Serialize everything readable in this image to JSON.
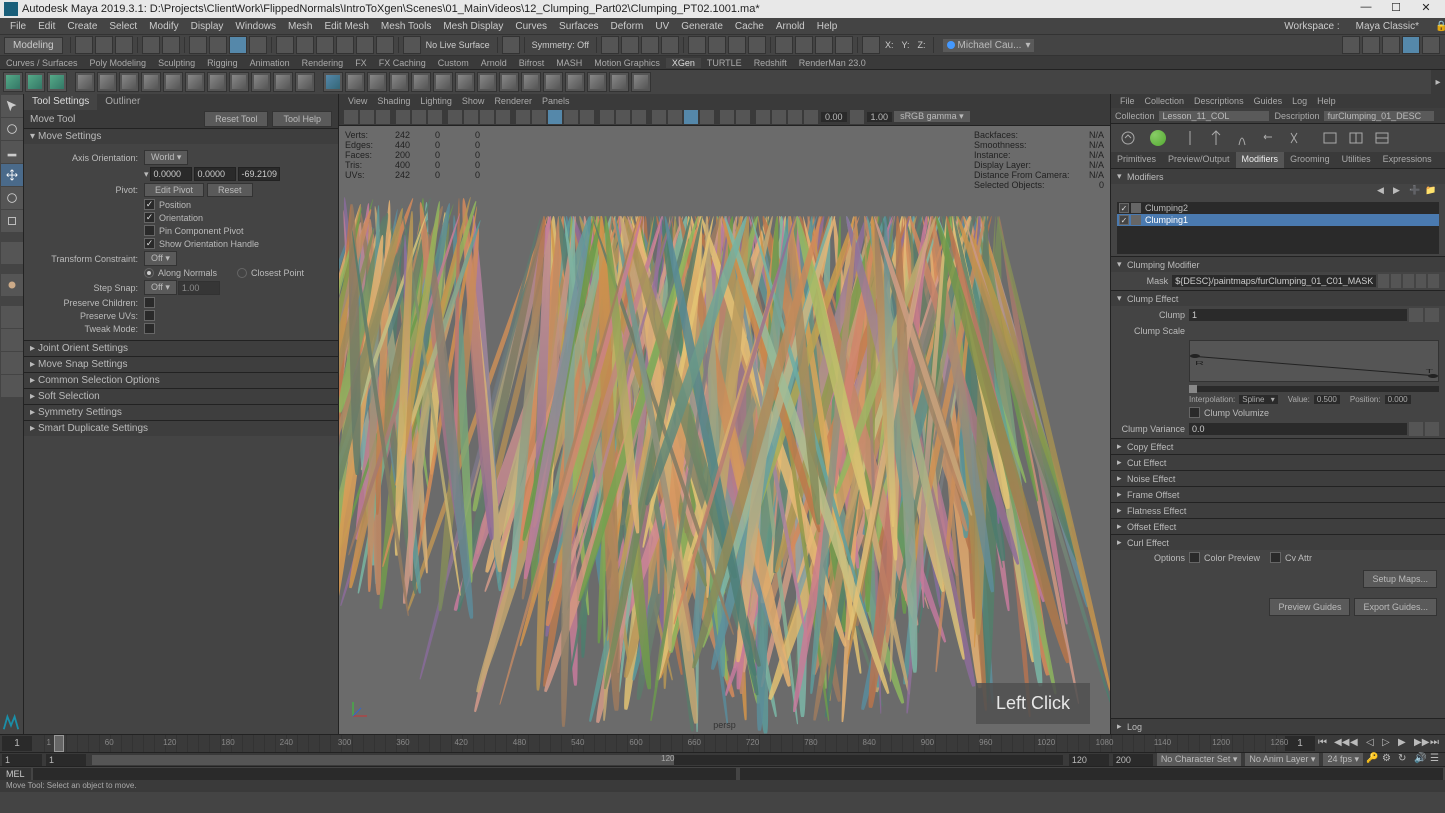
{
  "titlebar": {
    "title": "Autodesk Maya 2019.3.1: D:\\Projects\\ClientWork\\FlippedNormals\\IntroToXgen\\Scenes\\01_MainVideos\\12_Clumping_Part02\\Clumping_PT02.1001.ma*"
  },
  "menubar": {
    "items": [
      "File",
      "Edit",
      "Create",
      "Select",
      "Modify",
      "Display",
      "Windows",
      "Mesh",
      "Edit Mesh",
      "Mesh Tools",
      "Mesh Display",
      "Curves",
      "Surfaces",
      "Deform",
      "UV",
      "Generate",
      "Cache",
      "Arnold",
      "Help"
    ],
    "workspace_label": "Workspace :",
    "workspace_value": "Maya Classic*"
  },
  "toolrow": {
    "mode": "Modeling",
    "nolive": "No Live Surface",
    "sym": "Symmetry: Off",
    "account": "Michael Cau..."
  },
  "shelftabs": [
    "Curves / Surfaces",
    "Poly Modeling",
    "Sculpting",
    "Rigging",
    "Animation",
    "Rendering",
    "FX",
    "FX Caching",
    "Custom",
    "Arnold",
    "Bifrost",
    "MASH",
    "Motion Graphics",
    "XGen",
    "TURTLE",
    "Redshift",
    "RenderMan 23.0"
  ],
  "shelf_active": "XGen",
  "leftpanel": {
    "tabs": [
      "Tool Settings",
      "Outliner"
    ],
    "tool": "Move Tool",
    "reset": "Reset Tool",
    "help": "Tool Help",
    "movesettings": "Move Settings",
    "axis_label": "Axis Orientation:",
    "axis_value": "World",
    "coords": [
      "0.0000",
      "0.0000",
      "-69.2109"
    ],
    "pivot_label": "Pivot:",
    "edit_pivot": "Edit Pivot",
    "reset2": "Reset",
    "checks": [
      "Position",
      "Orientation",
      "Pin Component Pivot",
      "Show Orientation Handle"
    ],
    "transform_constraint": "Transform Constraint:",
    "tc_value": "Off",
    "along_normals": "Along Normals",
    "closest_point": "Closest Point",
    "step_snap": "Step Snap:",
    "ss_value": "Off",
    "ss_num": "1.00",
    "preserve_children": "Preserve Children:",
    "preserve_uvs": "Preserve UVs:",
    "tweak_mode": "Tweak Mode:",
    "collapsed": [
      "Joint Orient Settings",
      "Move Snap Settings",
      "Common Selection Options",
      "Soft Selection",
      "Symmetry Settings",
      "Smart Duplicate Settings"
    ]
  },
  "viewport": {
    "menu": [
      "View",
      "Shading",
      "Lighting",
      "Show",
      "Renderer",
      "Panels"
    ],
    "nums": [
      "0.00",
      "1.00"
    ],
    "colorspace": "sRGB gamma",
    "stats_labels": [
      "Verts:",
      "Edges:",
      "Faces:",
      "Tris:",
      "UVs:"
    ],
    "stats_c1": [
      "242",
      "440",
      "200",
      "400",
      "242"
    ],
    "stats_c2": [
      "0",
      "0",
      "0",
      "0",
      "0"
    ],
    "stats_c3": [
      "0",
      "0",
      "0",
      "0",
      "0"
    ],
    "rstats": [
      [
        "Backfaces:",
        "N/A"
      ],
      [
        "Smoothness:",
        "N/A"
      ],
      [
        "Instance:",
        "N/A"
      ],
      [
        "Display Layer:",
        "N/A"
      ],
      [
        "Distance From Camera:",
        "N/A"
      ],
      [
        "Selected Objects:",
        "0"
      ]
    ],
    "camera": "persp",
    "clicklabel": "Left Click"
  },
  "rightpanel": {
    "menu": [
      "File",
      "Collection",
      "Descriptions",
      "Guides",
      "Log",
      "Help"
    ],
    "collection_label": "Collection",
    "collection_value": "Lesson_11_COL",
    "description_label": "Description",
    "description_value": "furClumping_01_DESC",
    "tabs": [
      "Primitives",
      "Preview/Output",
      "Modifiers",
      "Grooming",
      "Utilities",
      "Expressions"
    ],
    "modifiers_header": "Modifiers",
    "mods": [
      {
        "name": "Clumping2",
        "selected": false
      },
      {
        "name": "Clumping1",
        "selected": true
      }
    ],
    "clumping_modifier": "Clumping Modifier",
    "mask_label": "Mask",
    "mask_value": "${DESC}/paintmaps/furClumping_01_C01_MASK",
    "clump_effect": "Clump Effect",
    "clump_label": "Clump",
    "clump_value": "1",
    "clump_scale": "Clump Scale",
    "interp": "Interpolation:",
    "interp_val": "Spline",
    "value_lbl": "Value:",
    "value_val": "0.500",
    "pos_lbl": "Position:",
    "pos_val": "0.000",
    "clump_volumize": "Clump Volumize",
    "clump_variance": "Clump Variance",
    "cv_value": "0.0",
    "collapsed_effects": [
      "Copy Effect",
      "Cut Effect",
      "Noise Effect",
      "Frame Offset",
      "Flatness Effect",
      "Offset Effect",
      "Curl Effect"
    ],
    "options": "Options",
    "color_preview": "Color Preview",
    "cv_attr": "Cv Attr",
    "setup_maps": "Setup Maps...",
    "preview_guides": "Preview Guides",
    "export_guides": "Export Guides...",
    "log": "Log"
  },
  "timeline": {
    "start": "1",
    "end_visible": "1260",
    "ticks": [
      1,
      60,
      120,
      180,
      240,
      300,
      360,
      420,
      480,
      540,
      600,
      660,
      720,
      780,
      840,
      900,
      960,
      1020,
      1080,
      1140,
      1200,
      1260
    ],
    "current": "1"
  },
  "rangebar": {
    "f1": "1",
    "f2": "1",
    "f3": "120",
    "range_end": "120",
    "f4": "200",
    "charset": "No Character Set",
    "animlayer": "No Anim Layer",
    "fps": "24 fps"
  },
  "melbar": {
    "label": "MEL"
  },
  "helpbar": {
    "text": "Move Tool: Select an object to move."
  }
}
